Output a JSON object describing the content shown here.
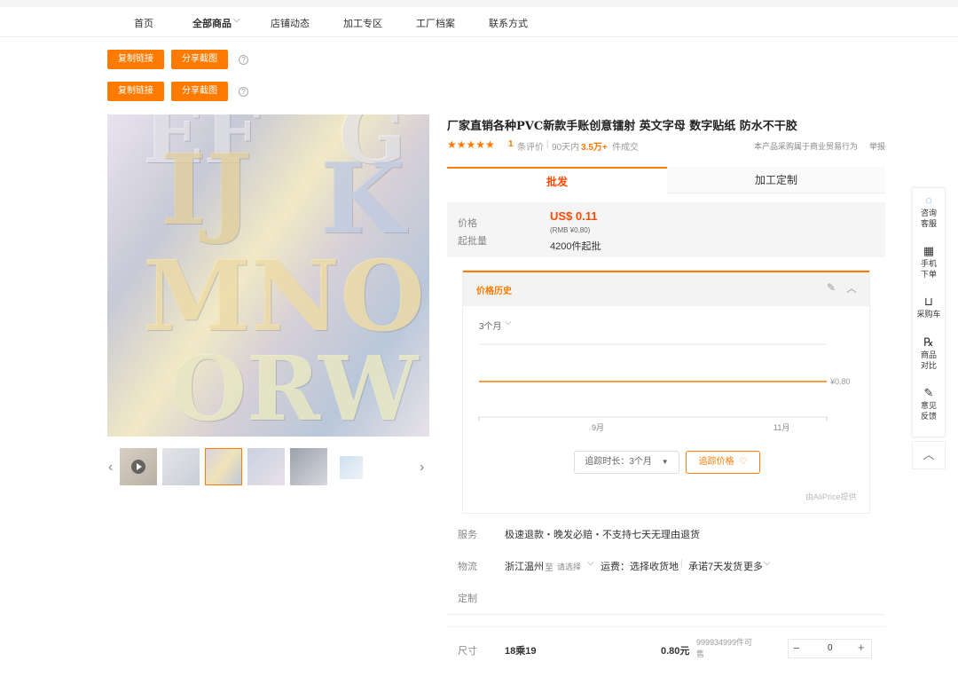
{
  "nav": {
    "items": [
      {
        "label": "首页",
        "active": false
      },
      {
        "label": "全部商品",
        "active": true,
        "has_dropdown": true
      },
      {
        "label": "店铺动态",
        "active": false
      },
      {
        "label": "加工专区",
        "active": false
      },
      {
        "label": "工厂档案",
        "active": false
      },
      {
        "label": "联系方式",
        "active": false
      }
    ]
  },
  "toolbar": {
    "copy_link": "复制链接",
    "share_screenshot": "分享截图",
    "help": "?"
  },
  "gallery": {
    "letters": [
      "EF",
      "G",
      "IJ",
      "K",
      "MNO",
      "ORW"
    ],
    "thumb_count": 6,
    "selected_index": 2
  },
  "product": {
    "title": "厂家直销各种PVC新款手账创意镭射 英文字母 数字贴纸 防水不干胶",
    "stars": "★★★★★",
    "review_count": "1",
    "review_suffix": "条评价",
    "sold_prefix": "90天内",
    "sold_value": "3.5万+",
    "sold_suffix": "件成交",
    "commercial_note": "本产品采购属于商业贸易行为",
    "report": "举报"
  },
  "tabs": {
    "wholesale": "批发",
    "custom": "加工定制"
  },
  "price": {
    "price_label": "价格",
    "moq_label": "起批量",
    "price_value": "US$ 0.11",
    "rmb_value": "(RMB ¥0.80)",
    "moq_value": "4200件起批"
  },
  "price_history": {
    "title": "价格历史",
    "range_label": "3个月",
    "line_label": "¥0.80",
    "track_duration": "追踪时长：3个月",
    "track_price": "追踪价格",
    "provider": "由AliPrice提供",
    "accent": "#ff7a00"
  },
  "chart_data": {
    "type": "line",
    "x": [
      "9月",
      "11月"
    ],
    "series": [
      {
        "values": [
          0.8,
          0.8
        ]
      }
    ],
    "ylabel": "",
    "annotation": "¥0.80"
  },
  "service": {
    "label": "服务",
    "value": "极速退款・晚发必赔・不支持七天无理由退货"
  },
  "logistics": {
    "label": "物流",
    "origin": "浙江温州",
    "to": "至",
    "select": "请选择",
    "fee": "运费：选择收货地",
    "promise": "承诺7天发货",
    "more": "更多"
  },
  "custom_row": {
    "label": "定制"
  },
  "sku": {
    "label": "尺寸",
    "size": "18乘19",
    "price": "0.80元",
    "stock": "999934999件可售",
    "minus": "−",
    "qty": "0",
    "plus": "+"
  },
  "float_bar": {
    "items": [
      {
        "label1": "咨询",
        "label2": "客服",
        "icon": "chat-icon"
      },
      {
        "label1": "手机",
        "label2": "下单",
        "icon": "qrcode-icon"
      },
      {
        "label1": "采购车",
        "label2": "",
        "icon": "cart-icon"
      },
      {
        "label1": "商品",
        "label2": "对比",
        "icon": "compare-icon"
      },
      {
        "label1": "意见",
        "label2": "反馈",
        "icon": "feedback-icon"
      }
    ],
    "top": "︿"
  }
}
